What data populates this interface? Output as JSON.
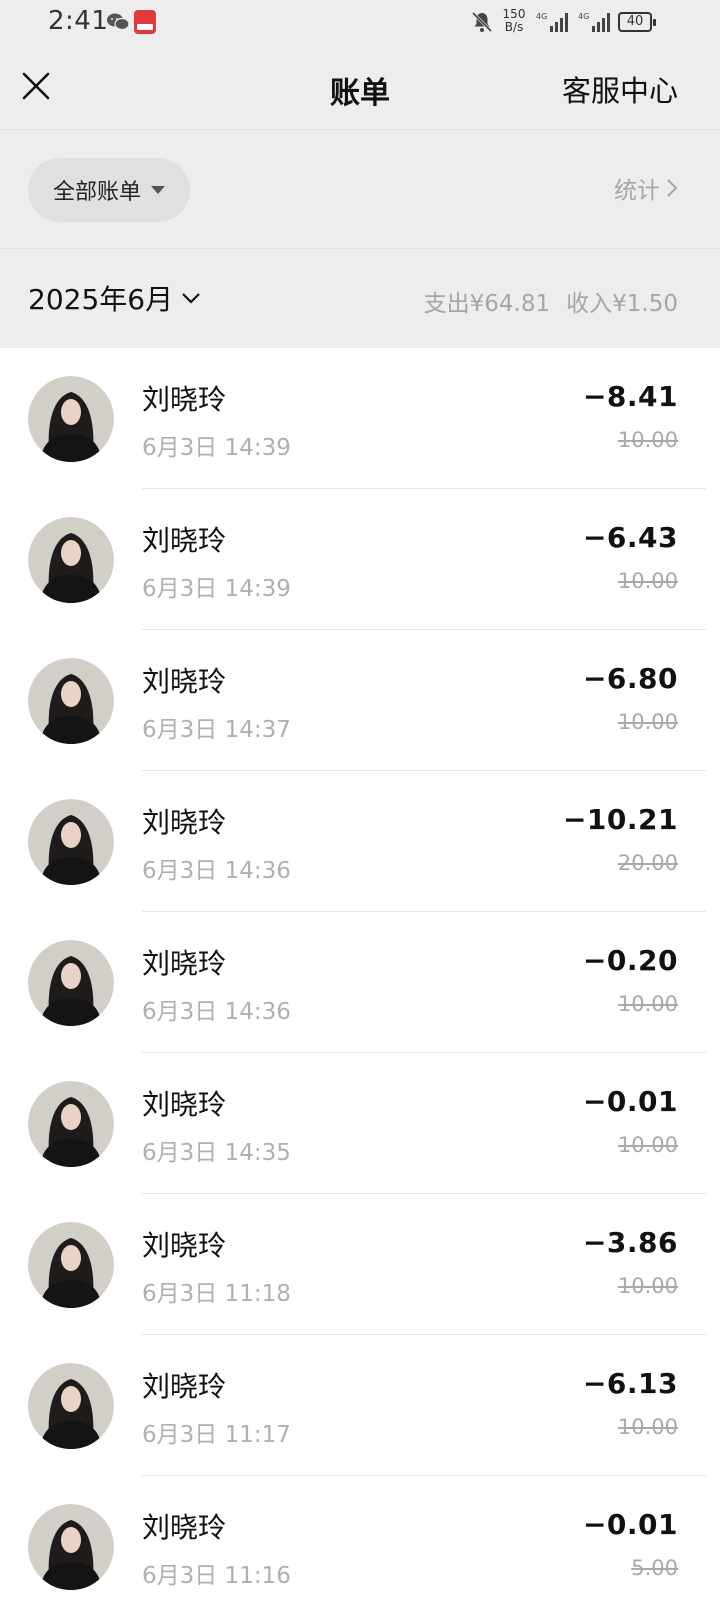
{
  "status_bar": {
    "time": "2:41",
    "net_speed_top": "150",
    "net_speed_bottom": "B/s",
    "battery": "40",
    "icons": [
      "wechat-icon",
      "app-icon",
      "bell-mute-icon",
      "signal-icon",
      "signal-icon",
      "battery-icon"
    ]
  },
  "nav": {
    "title": "账单",
    "service": "客服中心",
    "close_icon": "close-icon"
  },
  "filter": {
    "label": "全部账单",
    "stats": "统计"
  },
  "month": {
    "label": "2025年6月",
    "expense": "支出¥64.81",
    "income": "收入¥1.50"
  },
  "transactions": [
    {
      "name": "刘晓玲",
      "time": "6月3日 14:39",
      "amount": "−8.41",
      "original": "10.00"
    },
    {
      "name": "刘晓玲",
      "time": "6月3日 14:39",
      "amount": "−6.43",
      "original": "10.00"
    },
    {
      "name": "刘晓玲",
      "time": "6月3日 14:37",
      "amount": "−6.80",
      "original": "10.00"
    },
    {
      "name": "刘晓玲",
      "time": "6月3日 14:36",
      "amount": "−10.21",
      "original": "20.00"
    },
    {
      "name": "刘晓玲",
      "time": "6月3日 14:36",
      "amount": "−0.20",
      "original": "10.00"
    },
    {
      "name": "刘晓玲",
      "time": "6月3日 14:35",
      "amount": "−0.01",
      "original": "10.00"
    },
    {
      "name": "刘晓玲",
      "time": "6月3日 11:18",
      "amount": "−3.86",
      "original": "10.00"
    },
    {
      "name": "刘晓玲",
      "time": "6月3日 11:17",
      "amount": "−6.13",
      "original": "10.00"
    },
    {
      "name": "刘晓玲",
      "time": "6月3日 11:16",
      "amount": "−0.01",
      "original": "5.00"
    }
  ]
}
